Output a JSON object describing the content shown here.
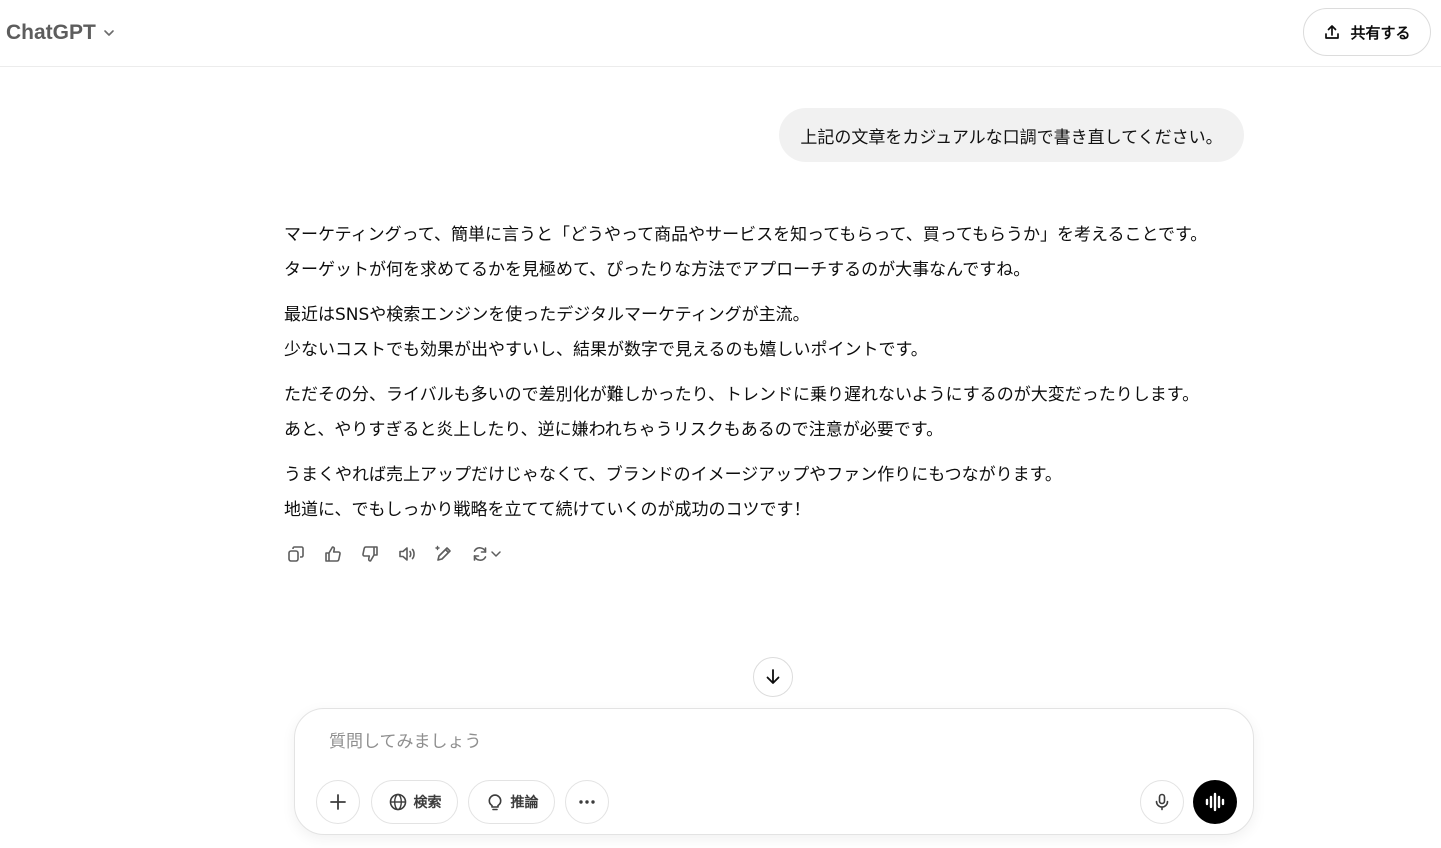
{
  "header": {
    "model_name": "ChatGPT",
    "share_label": "共有する"
  },
  "conversation": {
    "user_message": "上記の文章をカジュアルな口調で書き直してください。",
    "assistant_paragraphs": [
      [
        "マーケティングって、簡単に言うと「どうやって商品やサービスを知ってもらって、買ってもらうか」を考えることです。",
        "ターゲットが何を求めてるかを見極めて、ぴったりな方法でアプローチするのが大事なんですね。"
      ],
      [
        "最近はSNSや検索エンジンを使ったデジタルマーケティングが主流。",
        "少ないコストでも効果が出やすいし、結果が数字で見えるのも嬉しいポイントです。"
      ],
      [
        "ただその分、ライバルも多いので差別化が難しかったり、トレンドに乗り遅れないようにするのが大変だったりします。",
        "あと、やりすぎると炎上したり、逆に嫌われちゃうリスクもあるので注意が必要です。"
      ],
      [
        "うまくやれば売上アップだけじゃなくて、ブランドのイメージアップやファン作りにもつながります。",
        "地道に、でもしっかり戦略を立てて続けていくのが成功のコツです！"
      ]
    ],
    "message_actions": [
      "copy-icon",
      "thumbs-up-icon",
      "thumbs-down-icon",
      "read-aloud-icon",
      "edit-icon",
      "regenerate-icon"
    ]
  },
  "composer": {
    "placeholder": "質問してみましょう",
    "value": "",
    "tools": {
      "search_label": "検索",
      "reason_label": "推論"
    }
  },
  "colors": {
    "user_bubble": "#f1f1f1",
    "voice_button": "#000000",
    "muted_text": "#5d5d5d"
  }
}
